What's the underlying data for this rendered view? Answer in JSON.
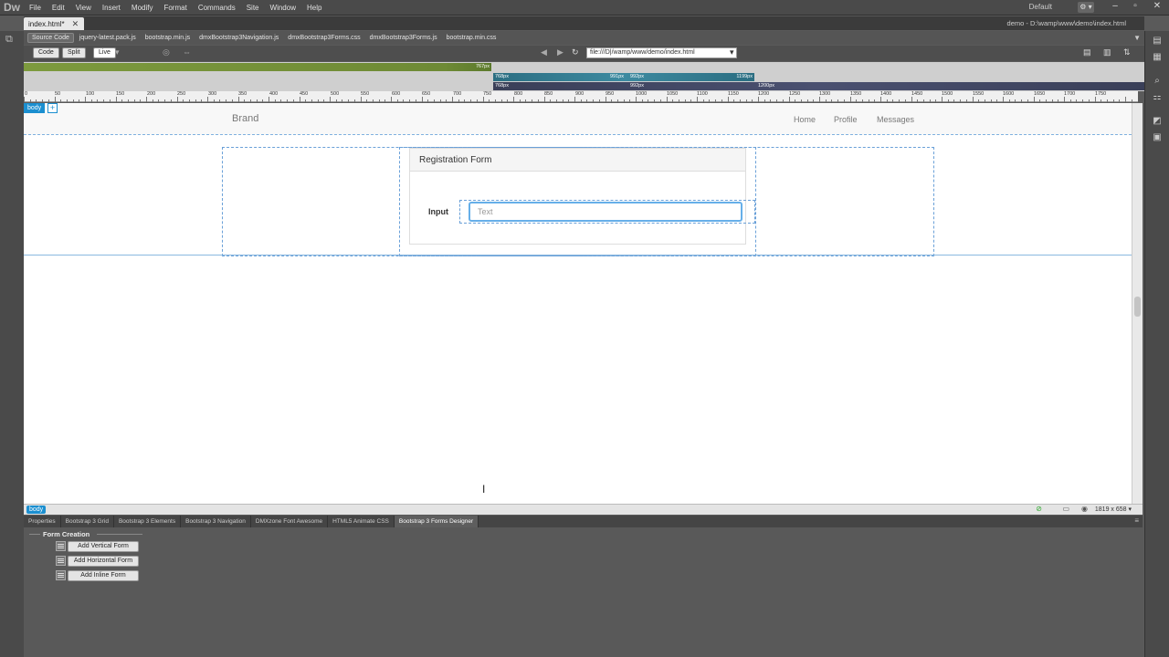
{
  "app": {
    "logo": "Dw",
    "menu": [
      "File",
      "Edit",
      "View",
      "Insert",
      "Modify",
      "Format",
      "Commands",
      "Site",
      "Window",
      "Help"
    ],
    "workspace": "Default",
    "gear": "⚙ ▾",
    "min": "–",
    "restore": "▫",
    "close": "✕"
  },
  "document": {
    "tab_label": "index.html*",
    "tab_close": "✕",
    "path": "demo - D:\\wamp\\www\\demo\\index.html"
  },
  "related_files": [
    "Source Code",
    "jquery-latest.pack.js",
    "bootstrap.min.js",
    "dmxBootstrap3Navigation.js",
    "dmxBootstrap3Forms.css",
    "dmxBootstrap3Forms.js",
    "bootstrap.min.css"
  ],
  "toolbar": {
    "code": "Code",
    "split": "Split",
    "live": "Live",
    "url": "file:///D|/wamp/www/demo/index.html"
  },
  "media_queries": {
    "mq1": "767px",
    "mq2_min": "768px",
    "mq2_a": "991px",
    "mq2_b": "992px",
    "mq2_max": "1199px",
    "mq3_min": "768px",
    "mq3_b": "992px",
    "mq3_max": "1200px"
  },
  "ruler_labels": [
    "0",
    "50",
    "100",
    "150",
    "200",
    "250",
    "300",
    "350",
    "400",
    "450",
    "500",
    "550",
    "600",
    "650",
    "700",
    "750",
    "800",
    "850",
    "900",
    "950",
    "1000",
    "1050",
    "1100",
    "1150",
    "1200",
    "1250",
    "1300",
    "1350",
    "1400",
    "1450",
    "1500",
    "1550",
    "1600",
    "1650",
    "1700",
    "1750"
  ],
  "design": {
    "body_tag": "body",
    "plus": "+",
    "brand": "Brand",
    "nav": [
      "Home",
      "Profile",
      "Messages"
    ],
    "panel_title": "Registration Form",
    "input_label": "Input",
    "input_placeholder": "Text"
  },
  "status": {
    "tag": "body",
    "window_size": "1819 x 658 ▾"
  },
  "panel_tabs": [
    "Properties",
    "Bootstrap 3 Grid",
    "Bootstrap 3 Elements",
    "Bootstrap 3 Navigation",
    "DMXzone Font Awesome",
    "HTML5 Animate CSS",
    "Bootstrap 3 Forms Designer"
  ],
  "active_panel_tab": 6,
  "form_creation": {
    "heading": "Form Creation",
    "buttons": [
      "Add Vertical Form",
      "Add Horizontal Form",
      "Add Inline Form"
    ]
  }
}
